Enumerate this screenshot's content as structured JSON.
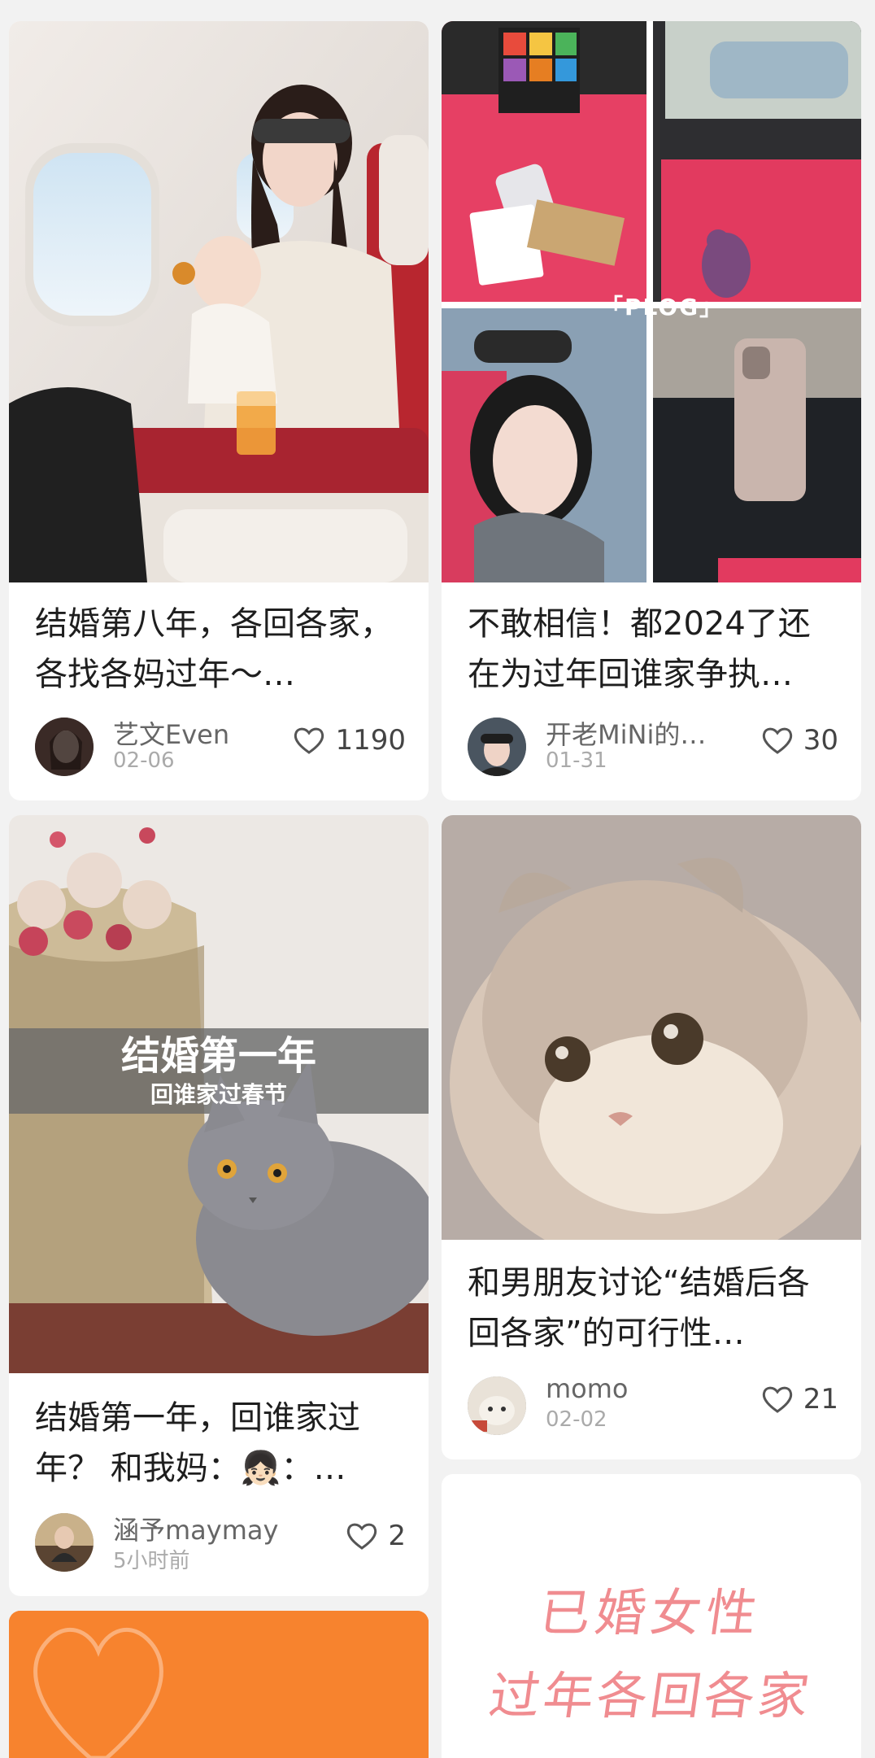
{
  "feed": {
    "cards": [
      {
        "title": "结婚第八年，各回各家，各找各妈过年～…",
        "author": "艺文Even",
        "date": "02-06",
        "likes": "1190"
      },
      {
        "title": "不敢相信！都2024了还在为过年回谁家争执…",
        "author": "开老MiNi的…",
        "date": "01-31",
        "likes": "30",
        "image_text": "「PLOG」"
      },
      {
        "title": "结婚第一年，回谁家过年？ 和我妈：👧🏻：…",
        "author": "涵予maymay",
        "date": "5小时前",
        "likes": "2",
        "image_title": "结婚第一年",
        "image_subtitle": "回谁家过春节"
      },
      {
        "title": "和男朋友讨论“结婚后各回各家”的可行性…",
        "author": "momo",
        "date": "02-02",
        "likes": "21"
      },
      {
        "image_line1": "已婚女性",
        "image_line2": "过年各回各家"
      }
    ]
  },
  "colors": {
    "background": "#f2f2f2",
    "orange_card": "#f7832e",
    "handwriting": "#f08c90"
  }
}
